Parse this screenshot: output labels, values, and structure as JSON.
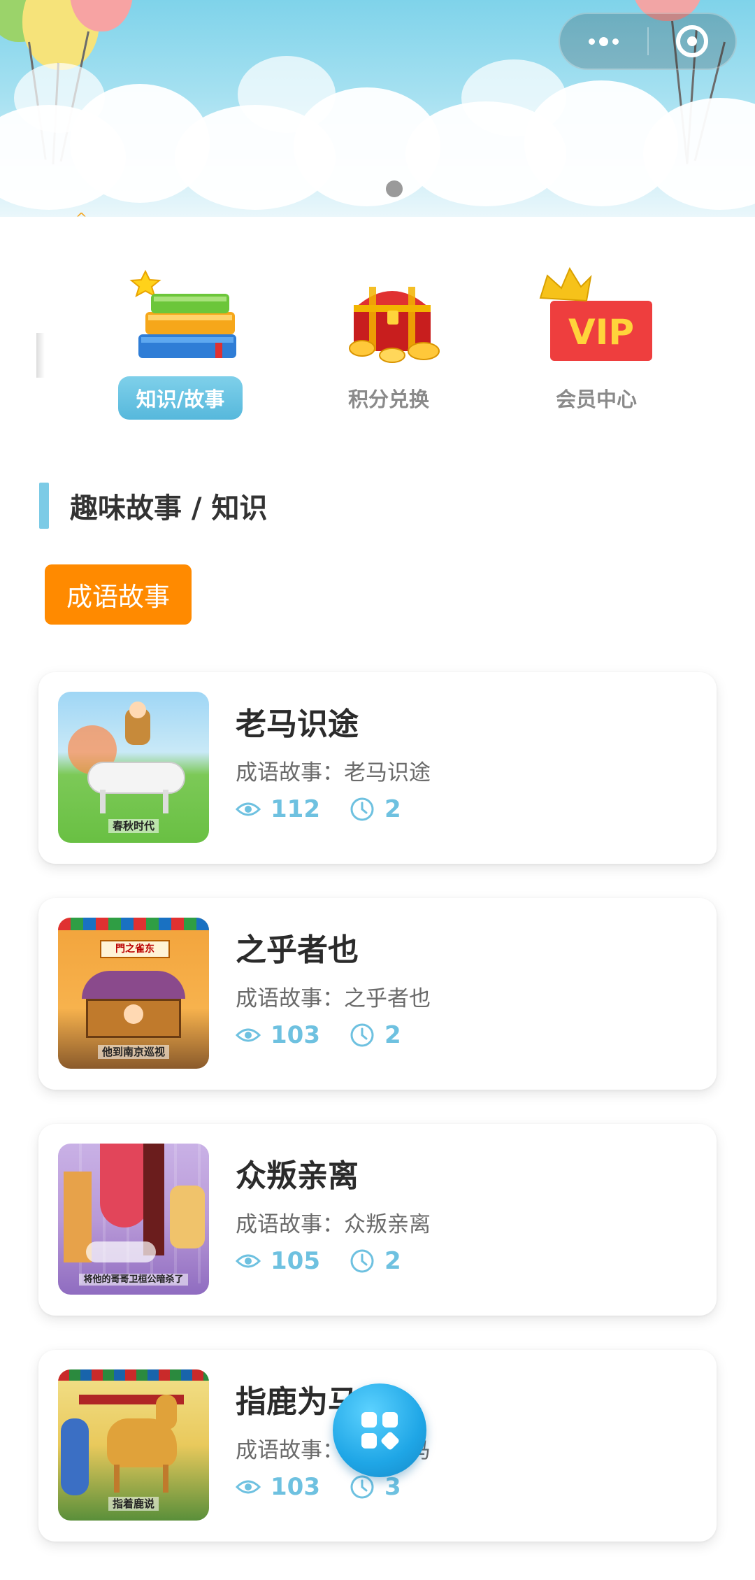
{
  "categories": [
    {
      "label": "知识/故事",
      "icon": "books-icon",
      "active": true
    },
    {
      "label": "积分兑换",
      "icon": "treasure-chest-icon",
      "active": false
    },
    {
      "label": "会员中心",
      "icon": "vip-crown-icon",
      "active": false
    }
  ],
  "section": {
    "title": "趣味故事 / 知识"
  },
  "filter": {
    "tag_label": "成语故事"
  },
  "stories": [
    {
      "title": "老马识途",
      "subtitle": "成语故事：老马识途",
      "views": "112",
      "duration": "2",
      "thumb_caption": "春秋时代"
    },
    {
      "title": "之乎者也",
      "subtitle": "成语故事：之乎者也",
      "views": "103",
      "duration": "2",
      "thumb_caption": "他到南京巡视",
      "thumb_sign": "門之雀东"
    },
    {
      "title": "众叛亲离",
      "subtitle": "成语故事：众叛亲离",
      "views": "105",
      "duration": "2",
      "thumb_caption": "将他的哥哥卫桓公暗杀了"
    },
    {
      "title": "指鹿为马",
      "subtitle": "成语故事：指鹿为马",
      "views": "103",
      "duration": "3",
      "thumb_caption": "指着鹿说"
    }
  ],
  "colors": {
    "accent": "#6ec1e0",
    "tag": "#ff8a00",
    "section_bar": "#7ccbe6"
  }
}
